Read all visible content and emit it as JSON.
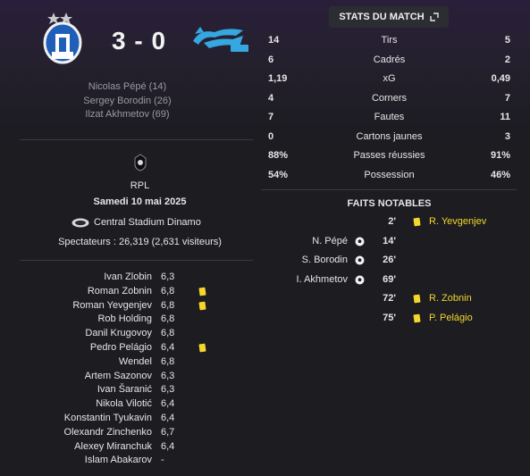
{
  "match": {
    "home_score": "3",
    "separator": "-",
    "away_score": "0",
    "scorers": [
      "Nicolas Pépé (14)",
      "Sergey Borodin (26)",
      "Ilzat Akhmetov (69)"
    ],
    "competition": "RPL",
    "date": "Samedi 10 mai 2025",
    "stadium": "Central Stadium Dinamo",
    "attendance": "Spectateurs : 26,319 (2,631 visiteurs)"
  },
  "ratings": [
    {
      "name": "Ivan Zlobin",
      "rating": "6,3",
      "yellow": false
    },
    {
      "name": "Roman Zobnin",
      "rating": "6,8",
      "yellow": true
    },
    {
      "name": "Roman Yevgenjev",
      "rating": "6,8",
      "yellow": true
    },
    {
      "name": "Rob Holding",
      "rating": "6,8",
      "yellow": false
    },
    {
      "name": "Danil Krugovoy",
      "rating": "6,8",
      "yellow": false
    },
    {
      "name": "Pedro Pelágio",
      "rating": "6,4",
      "yellow": true
    },
    {
      "name": "Wendel",
      "rating": "6,8",
      "yellow": false
    },
    {
      "name": "Artem Sazonov",
      "rating": "6,3",
      "yellow": false
    },
    {
      "name": "Ivan Šaranić",
      "rating": "6,3",
      "yellow": false
    },
    {
      "name": "Nikola Vilotić",
      "rating": "6,4",
      "yellow": false
    },
    {
      "name": "Konstantin Tyukavin",
      "rating": "6,4",
      "yellow": false
    },
    {
      "name": "Olexandr Zinchenko",
      "rating": "6,7",
      "yellow": false
    },
    {
      "name": "Alexey Miranchuk",
      "rating": "6,4",
      "yellow": false
    },
    {
      "name": "Islam Abakarov",
      "rating": "-",
      "yellow": false
    }
  ],
  "stats_button": {
    "label": "STATS DU MATCH",
    "icon": "expand-icon"
  },
  "stats": [
    {
      "label": "Tirs",
      "home": "14",
      "away": "5"
    },
    {
      "label": "Cadrés",
      "home": "6",
      "away": "2"
    },
    {
      "label": "xG",
      "home": "1,19",
      "away": "0,49"
    },
    {
      "label": "Corners",
      "home": "4",
      "away": "7"
    },
    {
      "label": "Fautes",
      "home": "7",
      "away": "11"
    },
    {
      "label": "Cartons jaunes",
      "home": "0",
      "away": "3"
    },
    {
      "label": "Passes réussies",
      "home": "88%",
      "away": "91%"
    },
    {
      "label": "Possession",
      "home": "54%",
      "away": "46%"
    }
  ],
  "notable": {
    "title": "FAITS NOTABLES",
    "events": [
      {
        "minute": "2'",
        "home": "",
        "away": "R. Yevgenjev",
        "type": "yellow-card"
      },
      {
        "minute": "14'",
        "home": "N. Pépé",
        "away": "",
        "type": "goal"
      },
      {
        "minute": "26'",
        "home": "S. Borodin",
        "away": "",
        "type": "goal"
      },
      {
        "minute": "69'",
        "home": "I. Akhmetov",
        "away": "",
        "type": "goal"
      },
      {
        "minute": "72'",
        "home": "",
        "away": "R. Zobnin",
        "type": "yellow-card"
      },
      {
        "minute": "75'",
        "home": "",
        "away": "P. Pelágio",
        "type": "yellow-card"
      }
    ]
  },
  "colors": {
    "accent_yellow": "#f5d62b",
    "home_blue": "#1f5fb8",
    "away_cyan": "#35a8e0"
  }
}
